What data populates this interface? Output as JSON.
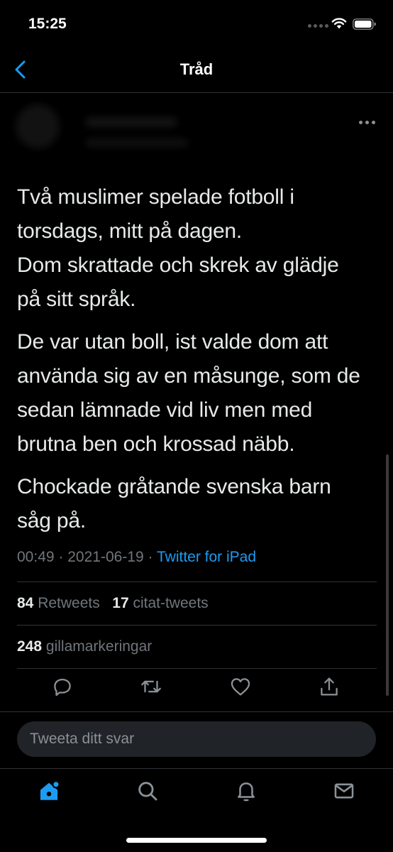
{
  "status_bar": {
    "time": "15:25"
  },
  "nav": {
    "title": "Tråd"
  },
  "tweet": {
    "paragraphs": [
      "Två muslimer spelade fotboll i\ntorsdags, mitt på dagen.\nDom skrattade och skrek av glädje\npå sitt språk.",
      "De var utan boll, ist valde dom att\nanvända sig av en måsunge, som de\nsedan lämnade vid liv men med\nbrutna ben och krossad näbb.",
      "Chockade gråtande svenska barn\nsåg på."
    ],
    "time": "00:49",
    "date": "2021-06-19",
    "separator": "·",
    "source": "Twitter for iPad"
  },
  "stats": {
    "retweets_count": "84",
    "retweets_label": "Retweets",
    "quotes_count": "17",
    "quotes_label": "citat-tweets",
    "likes_count": "248",
    "likes_label": "gillamarkeringar"
  },
  "reply": {
    "placeholder": "Tweeta ditt svar"
  },
  "colors": {
    "accent": "#1d9bf0",
    "background": "#000000",
    "muted": "#71767b",
    "text": "#e7e9ea"
  },
  "icons": {
    "actions": [
      "reply-icon",
      "retweet-icon",
      "like-icon",
      "share-icon"
    ],
    "tabs": [
      "home-icon",
      "search-icon",
      "notifications-icon",
      "messages-icon"
    ]
  }
}
